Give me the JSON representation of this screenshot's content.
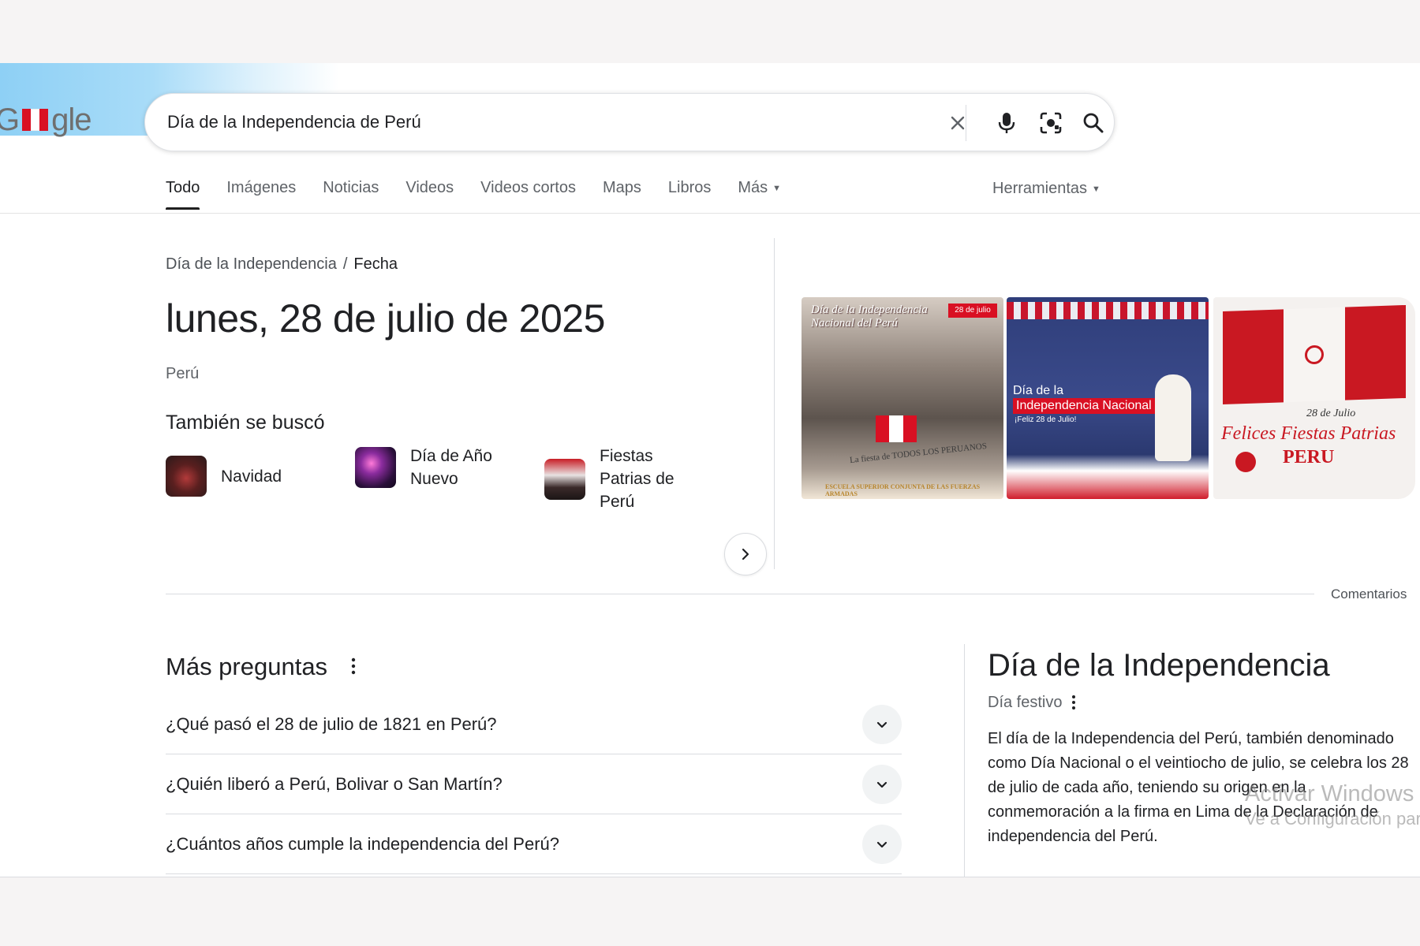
{
  "logo": {
    "text_left": "G",
    "text_right": "gle"
  },
  "search": {
    "query": "Día de la Independencia de Perú"
  },
  "tabs": [
    {
      "label": "Todo",
      "active": true
    },
    {
      "label": "Imágenes"
    },
    {
      "label": "Noticias"
    },
    {
      "label": "Videos"
    },
    {
      "label": "Videos cortos"
    },
    {
      "label": "Maps"
    },
    {
      "label": "Libros"
    },
    {
      "label": "Más"
    }
  ],
  "tools_label": "Herramientas",
  "breadcrumb": {
    "parent": "Día de la Independencia",
    "sep": "/",
    "current": "Fecha"
  },
  "answer": {
    "date": "lunes, 28 de julio de 2025",
    "country": "Perú"
  },
  "also_searched": {
    "title": "También se buscó",
    "items": [
      {
        "label": "Navidad"
      },
      {
        "label": "Día de Año Nuevo"
      },
      {
        "label": "Fiestas Patrias de Perú"
      }
    ]
  },
  "images": {
    "img1": {
      "title": "Día de la Independencia Nacional del Perú",
      "badge": "28 de julio",
      "caption": "La fiesta de TODOS LOS PERUANOS",
      "footer": "ESCUELA SUPERIOR CONJUNTA DE LAS FUERZAS ARMADAS"
    },
    "img2": {
      "title_1": "Día de la",
      "title_2": "Independencia Nacional",
      "subtitle": "¡Feliz 28 de Julio!"
    },
    "img3": {
      "date": "28 de Julio",
      "greeting": "Felices Fiestas Patrias",
      "country": "PERU"
    }
  },
  "feedback_label": "Comentarios",
  "more_questions": {
    "title": "Más preguntas",
    "items": [
      "¿Qué pasó el 28 de julio de 1821 en Perú?",
      "¿Quién liberó a Perú, Bolivar o San Martín?",
      "¿Cuántos años cumple la independencia del Perú?"
    ]
  },
  "knowledge_panel": {
    "title": "Día de la Independencia",
    "subtitle": "Día festivo",
    "description": "El día de la Independencia del Perú, también denominado como Día Nacional o el veintiocho de julio, se celebra los 28 de julio de cada año, teniendo su origen en la conmemoración a la firma en Lima de la Declaración de independencia del Perú."
  },
  "watermark": {
    "line1": "Activar Windows",
    "line2": "Ve a Configuración para activar Windows."
  },
  "colors": {
    "peru_red": "#d91023",
    "link_grey": "#5f6368",
    "text": "#202124"
  }
}
